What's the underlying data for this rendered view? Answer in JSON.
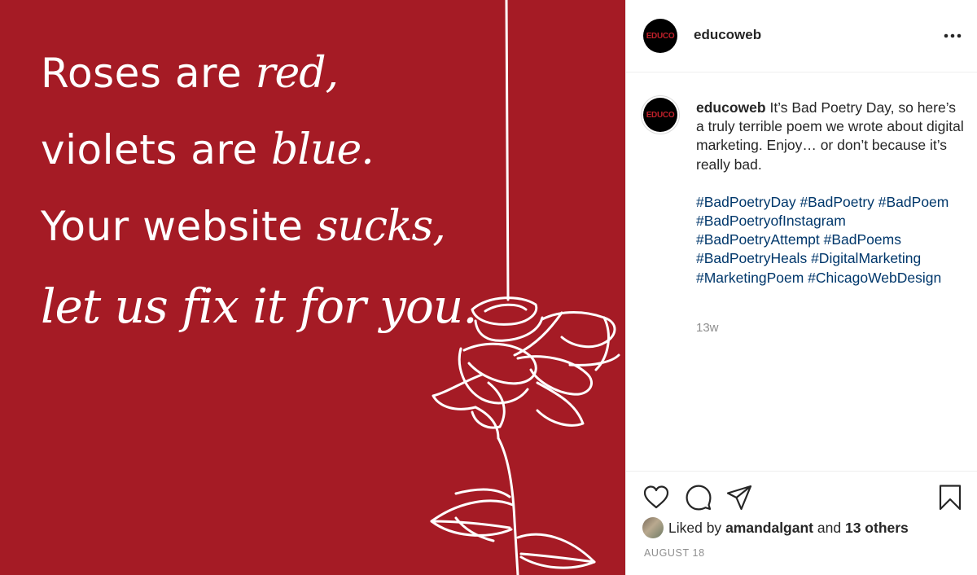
{
  "image": {
    "background_color": "#a51b25",
    "poem": {
      "line1": {
        "plain": "Roses are ",
        "script": "red,"
      },
      "line2": {
        "plain": "violets are ",
        "script": "blue."
      },
      "line3": {
        "plain": "Your website ",
        "script": "sucks,"
      },
      "line4": {
        "script": "let us fix it for you."
      }
    }
  },
  "header": {
    "avatar_text": "EDUCO",
    "username": "educoweb",
    "more_icon": "more-options-icon"
  },
  "caption": {
    "avatar_text": "EDUCO",
    "username": "educoweb",
    "text": "It’s Bad Poetry Day, so here’s a truly terrible poem we wrote about digital marketing. Enjoy… or don’t because it’s really bad.",
    "hashtags": [
      "#BadPoetryDay",
      "#BadPoetry",
      "#BadPoem",
      "#BadPoetryofInstagram",
      "#BadPoetryAttempt",
      "#BadPoems",
      "#BadPoetryHeals",
      "#DigitalMarketing",
      "#MarketingPoem",
      "#ChicagoWebDesign"
    ],
    "relative_time": "13w"
  },
  "actions": {
    "icons": [
      "heart-icon",
      "comment-icon",
      "share-icon",
      "bookmark-icon"
    ]
  },
  "likes": {
    "prefix": "Liked by",
    "user": "amandalgant",
    "connector": "and",
    "others": "13 others"
  },
  "date": "AUGUST 18",
  "colors": {
    "brand_red": "#a51b25",
    "hashtag": "#00376b",
    "muted": "#8e8e8e",
    "text": "#262626"
  }
}
